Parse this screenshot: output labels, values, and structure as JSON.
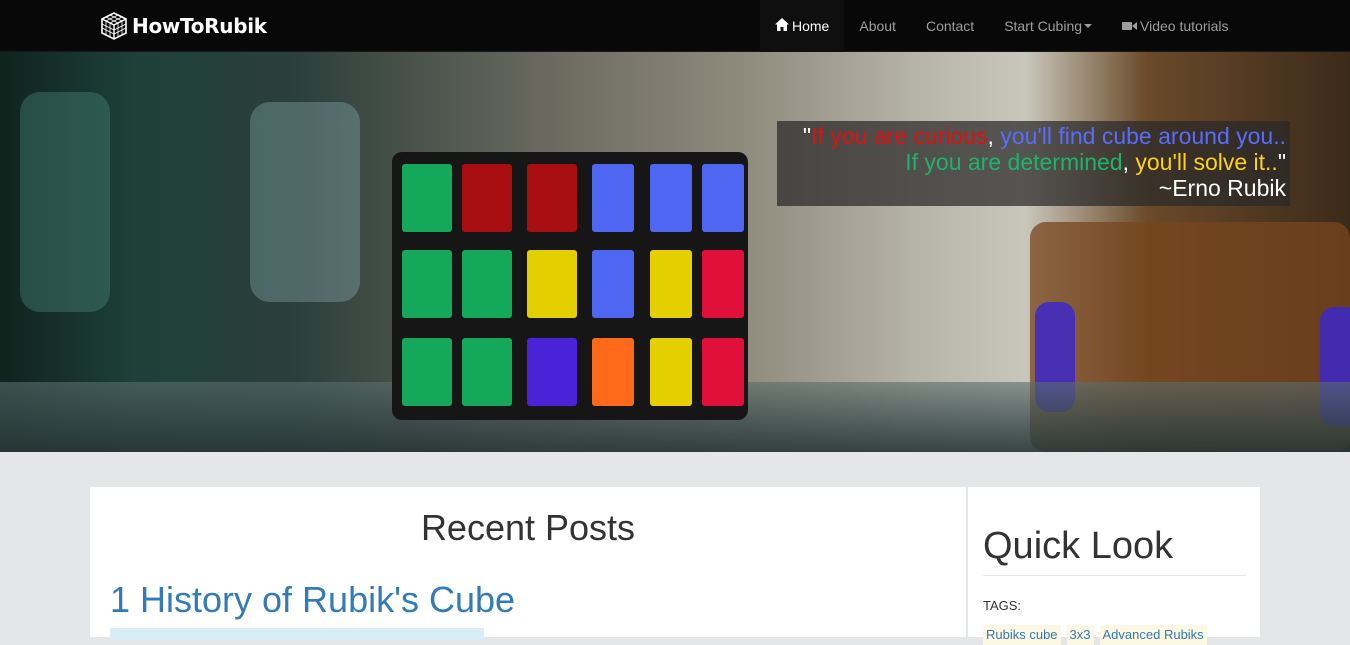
{
  "navbar": {
    "brand": "HowToRubik",
    "brand_icon": "cube-logo-icon",
    "items": [
      {
        "label": "Home",
        "icon": "home-icon",
        "active": true
      },
      {
        "label": "About"
      },
      {
        "label": "Contact"
      },
      {
        "label": "Start Cubing",
        "dropdown": true
      },
      {
        "label": "Video tutorials",
        "icon": "video-camera-icon"
      }
    ]
  },
  "hero": {
    "quote": {
      "open_quote": "\"",
      "part1_red": "If you are curious",
      "comma1": ",",
      "part1_blue": " you'll find cube around you..",
      "part2_green": "If you are determined",
      "comma2": ",",
      "part2_yellow": " you'll solve it..",
      "close_quote": "\"",
      "author": "~Erno Rubik"
    },
    "colors": {
      "red": "#e01010",
      "blue": "#5a6cff",
      "green": "#1fb36a",
      "yellow": "#ffd21a"
    }
  },
  "main": {
    "section_title": "Recent Posts",
    "posts": [
      {
        "title": "1 History of Rubik's Cube"
      }
    ]
  },
  "sidebar": {
    "title": "Quick Look",
    "tags_label": "TAGS:",
    "tags": [
      "Rubiks cube",
      "3x3",
      "Advanced Rubiks"
    ]
  }
}
